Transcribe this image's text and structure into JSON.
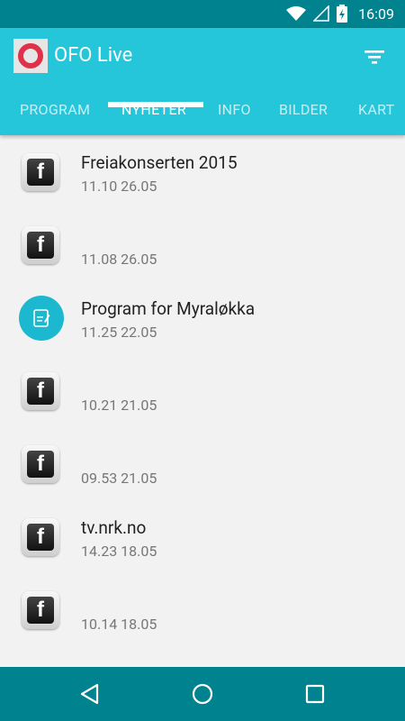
{
  "status_bar": {
    "time": "16:09",
    "icons": [
      "wifi-icon",
      "signal-icon",
      "battery-icon"
    ]
  },
  "app_bar": {
    "title": "OFO Live",
    "logo": "ofo-logo",
    "action_icon": "filter-icon"
  },
  "tabs": [
    {
      "label": "PROGRAM",
      "active": false
    },
    {
      "label": "NYHETER",
      "active": true
    },
    {
      "label": "INFO",
      "active": false
    },
    {
      "label": "BILDER",
      "active": false
    },
    {
      "label": "KART",
      "active": false
    }
  ],
  "news_items": [
    {
      "icon": "facebook-icon",
      "title": "Freiakonserten 2015",
      "date": "11.10 26.05"
    },
    {
      "icon": "facebook-icon",
      "title": "",
      "date": "11.08 26.05"
    },
    {
      "icon": "document-icon",
      "title": "Program for Myraløkka",
      "date": "11.25 22.05"
    },
    {
      "icon": "facebook-icon",
      "title": "",
      "date": "10.21 21.05"
    },
    {
      "icon": "facebook-icon",
      "title": "",
      "date": "09.53 21.05"
    },
    {
      "icon": "facebook-icon",
      "title": "tv.nrk.no",
      "date": "14.23 18.05"
    },
    {
      "icon": "facebook-icon",
      "title": "",
      "date": "10.14 18.05"
    }
  ],
  "nav_bar": {
    "icons": [
      "back-icon",
      "home-icon",
      "recents-icon"
    ]
  },
  "colors": {
    "status_bar": "#00838f",
    "app_bar": "#26c6da",
    "accent_circle": "#1cb8cf",
    "nav_bar": "#00838f"
  }
}
